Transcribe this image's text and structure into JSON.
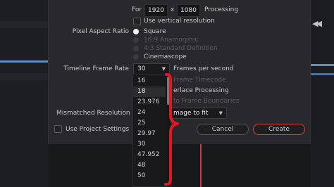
{
  "resolution": {
    "for_label": "For",
    "width": "1920",
    "x_label": "x",
    "height": "1080",
    "processing_label": "Processing"
  },
  "vertical_resolution": {
    "label": "Use vertical resolution",
    "checked": false
  },
  "pixel_aspect_ratio": {
    "label": "Pixel Aspect Ratio",
    "options": [
      {
        "label": "Square",
        "selected": true,
        "enabled": true
      },
      {
        "label": "16:9 Anamorphic",
        "selected": false,
        "enabled": false
      },
      {
        "label": "4:3 Standard Definition",
        "selected": false,
        "enabled": false
      },
      {
        "label": "Cinemascope",
        "selected": false,
        "enabled": true
      }
    ]
  },
  "timeline_frame_rate": {
    "label": "Timeline Frame Rate",
    "value": "30",
    "suffix": "Frames per second",
    "options": [
      "16",
      "18",
      "23.976",
      "24",
      "25",
      "29.97",
      "30",
      "47.952",
      "48",
      "50"
    ],
    "highlighted": "18"
  },
  "hidden_options": {
    "drop_frame_text": "Frame Timecode",
    "interlace_text": "erlace Processing",
    "frame_boundaries_text": "to Frame Boundaries"
  },
  "mismatched_resolution": {
    "label": "Mismatched Resolution",
    "value": "mage to fit"
  },
  "project_settings": {
    "label": "Use Project Settings",
    "checked": false
  },
  "buttons": {
    "cancel": "Cancel",
    "create": "Create"
  },
  "colors": {
    "annotation_red": "#e3171d",
    "accent": "#d2433c",
    "playhead": "#c8374b"
  },
  "icons": {
    "rewind": "rewind-icon",
    "chevron": "chevron-down-icon"
  }
}
